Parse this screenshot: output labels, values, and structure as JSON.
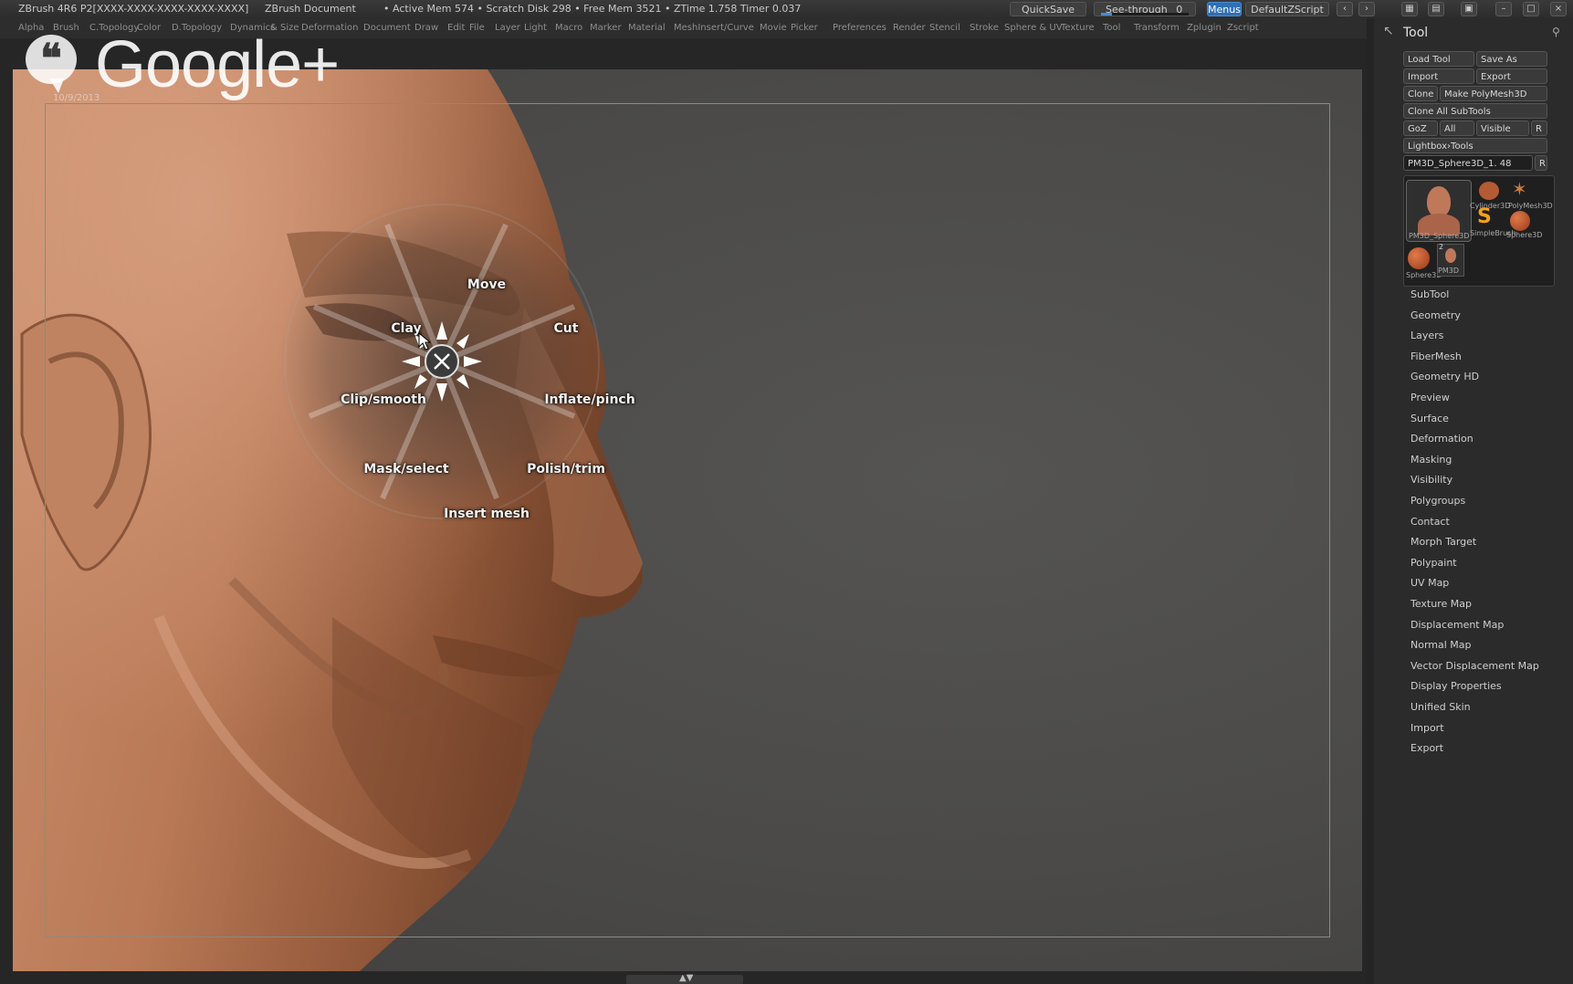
{
  "titlebar": {
    "app_info": "ZBrush 4R6 P2[XXXX-XXXX-XXXX-XXXX-XXXX]",
    "document": "ZBrush Document",
    "stats": "• Active Mem 574 • Scratch Disk 298 • Free Mem 3521 • ZTime 1.758 Timer 0.037",
    "quicksave_label": "QuickSave",
    "seethrough_label": "See-through",
    "seethrough_value": "0",
    "seethrough_level": 0,
    "menus_label": "Menus",
    "script_label": "DefaultZScript"
  },
  "menubar": {
    "items": [
      "Alpha",
      "Brush",
      "C.Topology",
      "Color",
      "D.Topology",
      "Dynamics",
      "& Size",
      "Deformation",
      "Document",
      "Draw",
      "Edit",
      "File",
      "Layer",
      "Light",
      "Macro",
      "Marker",
      "Material",
      "MeshInsert/Curve",
      "Movie",
      "Picker",
      "Preferences",
      "Render",
      "Stencil",
      "Stroke",
      "Sphere & UV",
      "Texture",
      "Tool",
      "Transform",
      "Zplugin",
      "Zscript"
    ]
  },
  "overlay": {
    "brand": "Google+",
    "quote_glyph": "❝",
    "subtext": "10/9/2013"
  },
  "pie_menu": {
    "center_icon": "close-x-icon",
    "items": [
      {
        "label": "Move"
      },
      {
        "label": "Cut"
      },
      {
        "label": "Inflate/pinch"
      },
      {
        "label": "Polish/trim"
      },
      {
        "label": "Insert mesh"
      },
      {
        "label": "Mask/select"
      },
      {
        "label": "Clip/smooth"
      },
      {
        "label": "Clay"
      }
    ]
  },
  "tool_panel": {
    "title": "Tool",
    "buttons": {
      "load_tool": "Load Tool",
      "save_as": "Save As",
      "import": "Import",
      "export": "Export",
      "clone": "Clone",
      "make_polymesh": "Make PolyMesh3D",
      "clone_all": "Clone All SubTools",
      "goz": "GoZ",
      "all": "All",
      "visible": "Visible",
      "r": "R",
      "lightbox_tools": "Lightbox›Tools",
      "current_tool": "PM3D_Sphere3D_1. 48",
      "current_tool_r": "R"
    },
    "thumbnails": [
      "PM3D_Sphere3D",
      "Cylinder3D",
      "PolyMesh3D",
      "SimpleBrush",
      "Sphere3D",
      "Sphere3D",
      "PM3D"
    ],
    "thumb_badge": "2",
    "sections": [
      "SubTool",
      "Geometry",
      "Layers",
      "FiberMesh",
      "Geometry HD",
      "Preview",
      "Surface",
      "Deformation",
      "Masking",
      "Visibility",
      "Polygroups",
      "Contact",
      "Morph Target",
      "Polypaint",
      "UV Map",
      "Texture Map",
      "Displacement Map",
      "Normal Map",
      "Vector Displacement Map",
      "Display Properties",
      "Unified Skin",
      "Import",
      "Export"
    ]
  },
  "colors": {
    "accent": "#2f6fb5",
    "skin": "#b87a58",
    "canvas": "#4a4a48"
  }
}
